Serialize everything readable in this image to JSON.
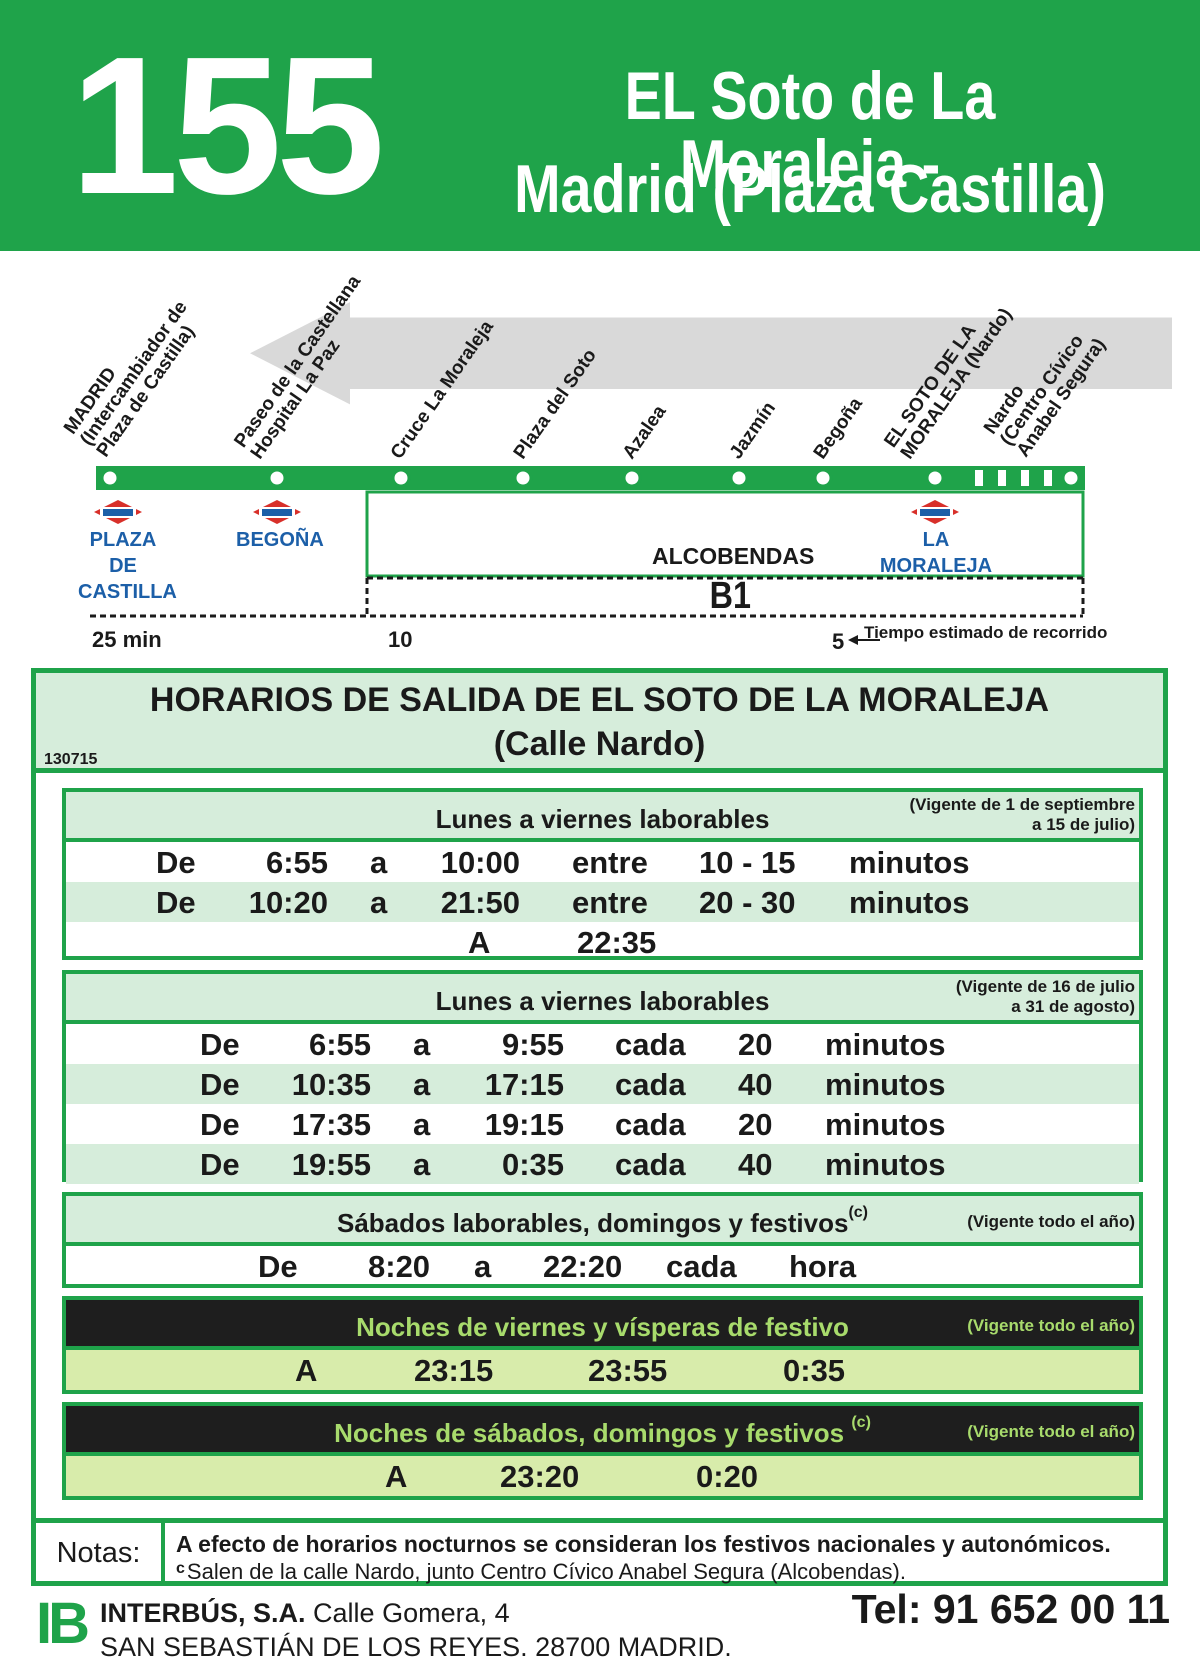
{
  "header": {
    "route_number": "155",
    "title_line1": "EL Soto de La Moraleja -",
    "title_line2": "Madrid (Plaza Castilla)"
  },
  "map": {
    "stops": [
      {
        "lines": [
          "MADRID",
          "(Intercambiador de",
          "Plaza de Castilla)"
        ]
      },
      {
        "lines": [
          "Paseo de la Castellana",
          "Hospital La Paz"
        ]
      },
      {
        "lines": [
          "Cruce La Moraleja"
        ]
      },
      {
        "lines": [
          "Plaza del Soto"
        ]
      },
      {
        "lines": [
          "Azalea"
        ]
      },
      {
        "lines": [
          "Jazmín"
        ]
      },
      {
        "lines": [
          "Begoña"
        ]
      },
      {
        "lines": [
          "EL SOTO DE LA",
          "MORALEJA (Nardo)"
        ]
      },
      {
        "lines": [
          "Nardo",
          "(Centro Cívico",
          "Anabel Segura)"
        ]
      }
    ],
    "metro_badge": "Metro",
    "metro_stations": [
      "PLAZA DE CASTILLA",
      "BEGOÑA",
      "LA MORALEJA"
    ],
    "metro_station_lines": {
      "plaza_line1": "PLAZA DE",
      "plaza_line2": "CASTILLA",
      "begona": "BEGOÑA",
      "moraleja": "LA MORALEJA"
    },
    "zone_name": "ALCOBENDAS",
    "zone_code": "B1",
    "times": {
      "t1": "25 min",
      "t2": "10",
      "t3": "5"
    },
    "time_note": "Tiempo estimado de recorrido",
    "colors": {
      "brand_green": "#1fa34a",
      "metro_red": "#d8302a",
      "metro_blue": "#1c5fa8",
      "arrow_gray": "#d9d9d9"
    }
  },
  "schedule": {
    "title_line1": "HORARIOS DE SALIDA DE EL SOTO DE LA MORALEJA",
    "title_line2": "(Calle Nardo)",
    "code": "130715",
    "sections": [
      {
        "title": "Lunes a viernes laborables",
        "valid_line1": "(Vigente de 1 de septiembre",
        "valid_line2": "a 15 de julio)",
        "rows": [
          {
            "de": "De",
            "from": "6:55",
            "a": "a",
            "to": "10:00",
            "mode": "entre",
            "freq": "10 - 15",
            "unit": "minutos"
          },
          {
            "de": "De",
            "from": "10:20",
            "a": "a",
            "to": "21:50",
            "mode": "entre",
            "freq": "20 - 30",
            "unit": "minutos"
          }
        ],
        "last": {
          "a": "A",
          "time": "22:35"
        }
      },
      {
        "title": "Lunes a viernes laborables",
        "valid_line1": "(Vigente de 16 de julio",
        "valid_line2": "a 31 de agosto)",
        "rows": [
          {
            "de": "De",
            "from": "6:55",
            "a": "a",
            "to": "9:55",
            "mode": "cada",
            "freq": "20",
            "unit": "minutos"
          },
          {
            "de": "De",
            "from": "10:35",
            "a": "a",
            "to": "17:15",
            "mode": "cada",
            "freq": "40",
            "unit": "minutos"
          },
          {
            "de": "De",
            "from": "17:35",
            "a": "a",
            "to": "19:15",
            "mode": "cada",
            "freq": "20",
            "unit": "minutos"
          },
          {
            "de": "De",
            "from": "19:55",
            "a": "a",
            "to": "0:35",
            "mode": "cada",
            "freq": "40",
            "unit": "minutos"
          }
        ]
      },
      {
        "title": "Sábados laborables, domingos y festivos",
        "sup": "(c)",
        "valid": "(Vigente todo el año)",
        "row": {
          "de": "De",
          "from": "8:20",
          "a": "a",
          "to": "22:20",
          "mode": "cada",
          "unit": "hora"
        }
      },
      {
        "title": "Noches de viernes y vísperas de festivo",
        "valid": "(Vigente todo el año)",
        "row": {
          "a": "A",
          "t1": "23:15",
          "t2": "23:55",
          "t3": "0:35"
        }
      },
      {
        "title": "Noches de sábados, domingos y festivos",
        "sup": "(c)",
        "valid": "(Vigente todo el año)",
        "row": {
          "a": "A",
          "t1": "23:20",
          "t2": "0:20"
        }
      }
    ],
    "notes": {
      "label": "Notas:",
      "line1": "A efecto de horarios nocturnos se consideran los festivos nacionales y autonómicos.",
      "line2_mark": "c",
      "line2": "Salen de la calle Nardo, junto Centro Cívico Anabel Segura (Alcobendas)."
    }
  },
  "footer": {
    "logo": "IB",
    "company": "INTERBÚS, S.A.",
    "address1": "Calle Gomera, 4",
    "address2": "SAN SEBASTIÁN DE LOS REYES. 28700 MADRID.",
    "tel": "Tel: 91 652 00 11"
  }
}
